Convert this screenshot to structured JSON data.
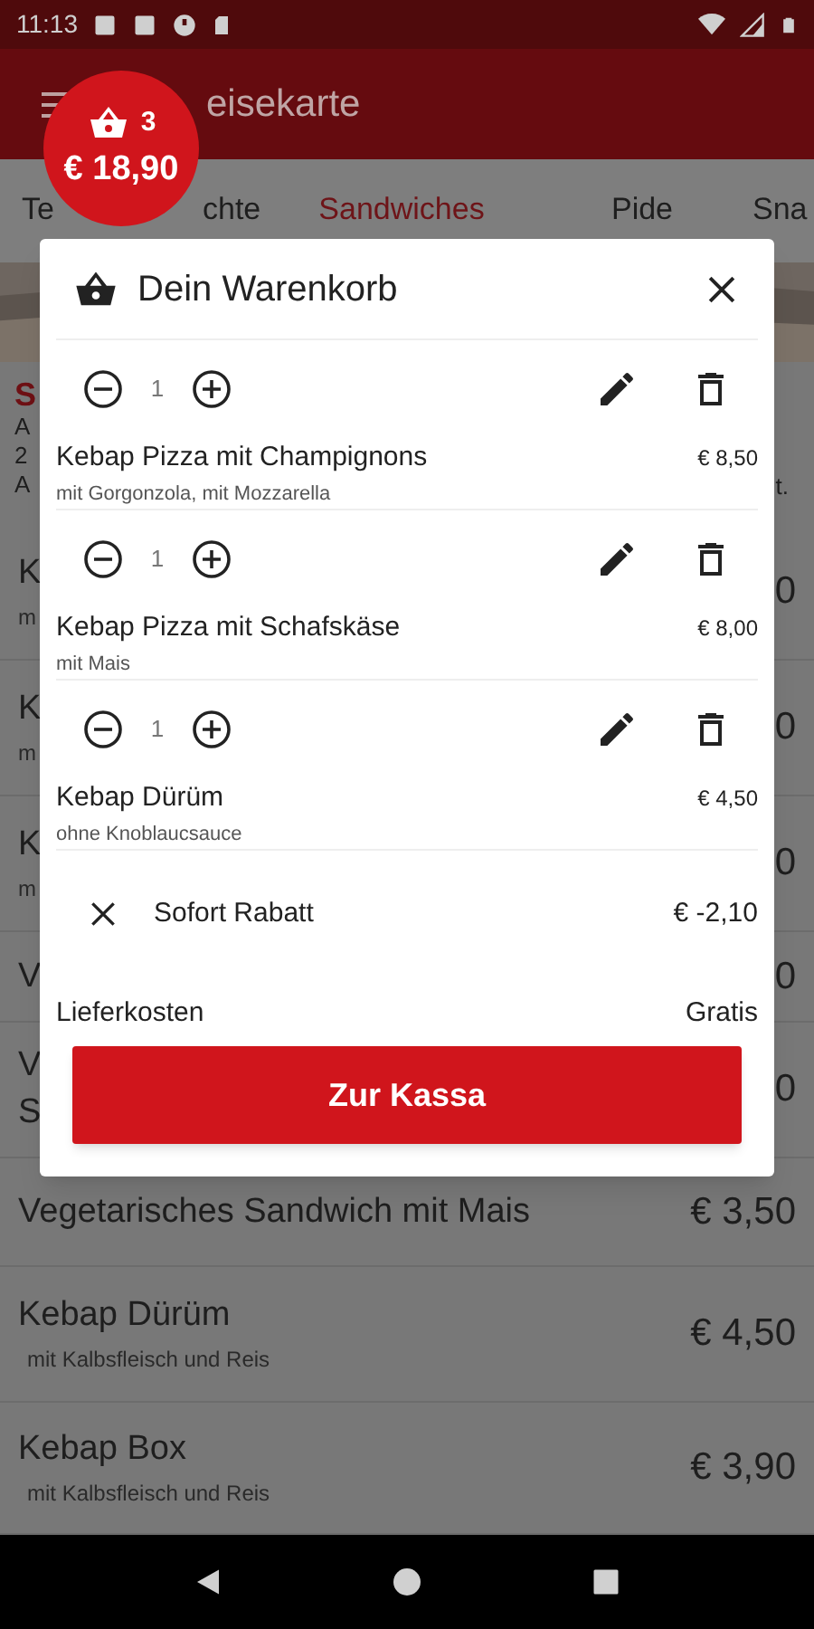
{
  "status_bar": {
    "time": "11:13"
  },
  "app_bar": {
    "title": "eisekarte"
  },
  "cart_badge": {
    "count": "3",
    "total": "€ 18,90"
  },
  "tabs": [
    {
      "label": "Te",
      "selected": false
    },
    {
      "label": "chte",
      "selected": false
    },
    {
      "label": "Sandwiches",
      "selected": true
    },
    {
      "label": "Pide",
      "selected": false
    },
    {
      "label": "Sna",
      "selected": false
    }
  ],
  "intro": {
    "title": "S",
    "lines": [
      "A",
      "2",
      "A"
    ],
    "line_end": "t."
  },
  "menu_items": [
    {
      "name": "K",
      "description": "m",
      "price": "0"
    },
    {
      "name": "K",
      "description": "m",
      "price": "0"
    },
    {
      "name": "K",
      "description": "m",
      "price": "0"
    },
    {
      "name": "V",
      "price": "0"
    },
    {
      "name": "V\nS",
      "price": "0"
    },
    {
      "name": "Vegetarisches Sandwich mit Mais",
      "price": "€ 3,50"
    },
    {
      "name": "Kebap Dürüm",
      "description": "mit Kalbsfleisch und Reis",
      "price": "€ 4,50"
    },
    {
      "name": "Kebap Box",
      "description": "mit Kalbsfleisch und Reis",
      "price": "€ 3,90"
    }
  ],
  "cart_dialog": {
    "title": "Dein Warenkorb",
    "items": [
      {
        "quantity": "1",
        "name": "Kebap Pizza mit Champignons",
        "options": "mit Gorgonzola, mit Mozzarella",
        "price": "€ 8,50"
      },
      {
        "quantity": "1",
        "name": "Kebap Pizza mit Schafskäse",
        "options": "mit Mais",
        "price": "€ 8,00"
      },
      {
        "quantity": "1",
        "name": "Kebap Dürüm",
        "options": "ohne Knoblaucsauce",
        "price": "€ 4,50"
      }
    ],
    "discount": {
      "label": "Sofort Rabatt",
      "amount": "€ -2,10"
    },
    "delivery": {
      "label": "Lieferkosten",
      "value": "Gratis"
    },
    "checkout_button": "Zur Kassa"
  }
}
